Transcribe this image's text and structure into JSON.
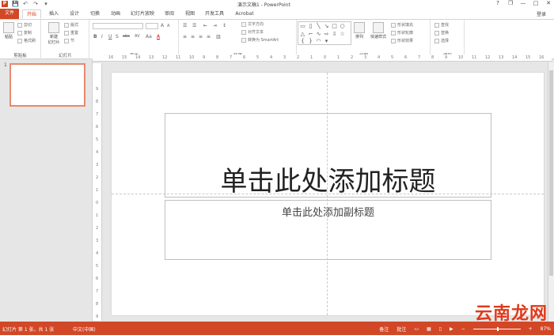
{
  "window": {
    "title": "演示文稿1 - PowerPoint",
    "logo_text": "P",
    "help": "?",
    "restore": "❐",
    "minimize": "—",
    "maximize": "□",
    "close": "✕"
  },
  "qat": {
    "save": "💾",
    "undo": "↶",
    "redo": "↷",
    "more": "▾"
  },
  "tabs": [
    {
      "label": "文件"
    },
    {
      "label": "开始"
    },
    {
      "label": "插入"
    },
    {
      "label": "设计"
    },
    {
      "label": "切换"
    },
    {
      "label": "动画"
    },
    {
      "label": "幻灯片放映"
    },
    {
      "label": "审阅"
    },
    {
      "label": "视图"
    },
    {
      "label": "开发工具"
    },
    {
      "label": "Acrobat"
    }
  ],
  "login": "登录",
  "ribbon": {
    "clipboard": {
      "label": "剪贴板",
      "paste": "粘贴",
      "cut": "剪切",
      "copy": "复制",
      "format_painter": "格式刷"
    },
    "slides": {
      "label": "幻灯片",
      "new_slide": "新建\n幻灯片",
      "layout": "版式",
      "reset": "重置",
      "section": "节"
    },
    "font": {
      "label": "字体",
      "bold": "B",
      "italic": "I",
      "underline": "U",
      "shadow": "S",
      "strike": "abc",
      "spacing": "AV",
      "case": "Aa",
      "color": "A",
      "grow": "A",
      "shrink": "A"
    },
    "paragraph": {
      "label": "段落",
      "text_direction": "文字方向",
      "align_text": "对齐文本",
      "smartart": "转换为 SmartArt"
    },
    "drawing": {
      "label": "绘图",
      "arrange": "排列",
      "quick_styles": "快速样式",
      "shape_fill": "形状填充",
      "shape_outline": "形状轮廓",
      "shape_effects": "形状效果"
    },
    "editing": {
      "label": "编辑",
      "find": "查找",
      "replace": "替换",
      "select": "选择"
    }
  },
  "ruler": {
    "h_labels": [
      "16",
      "15",
      "14",
      "13",
      "12",
      "11",
      "10",
      "9",
      "8",
      "7",
      "6",
      "5",
      "4",
      "3",
      "2",
      "1",
      "0",
      "1",
      "2",
      "3",
      "4",
      "5",
      "6",
      "7",
      "8",
      "9",
      "10",
      "11",
      "12",
      "13",
      "14",
      "15",
      "16"
    ],
    "v_labels": [
      "9",
      "8",
      "7",
      "6",
      "5",
      "4",
      "3",
      "2",
      "1",
      "0",
      "1",
      "2",
      "3",
      "4",
      "5",
      "6",
      "7",
      "8",
      "9"
    ]
  },
  "thumbnails": [
    {
      "number": "1"
    }
  ],
  "slide": {
    "title_placeholder": "单击此处添加标题",
    "subtitle_placeholder": "单击此处添加副标题"
  },
  "statusbar": {
    "slide_info": "幻灯片 第 1 张，共 1 张",
    "language": "中文(中国)",
    "notes": "备注",
    "comments": "批注",
    "zoom": "87%"
  },
  "watermark": "云南龙网",
  "colors": {
    "accent": "#d24726"
  }
}
